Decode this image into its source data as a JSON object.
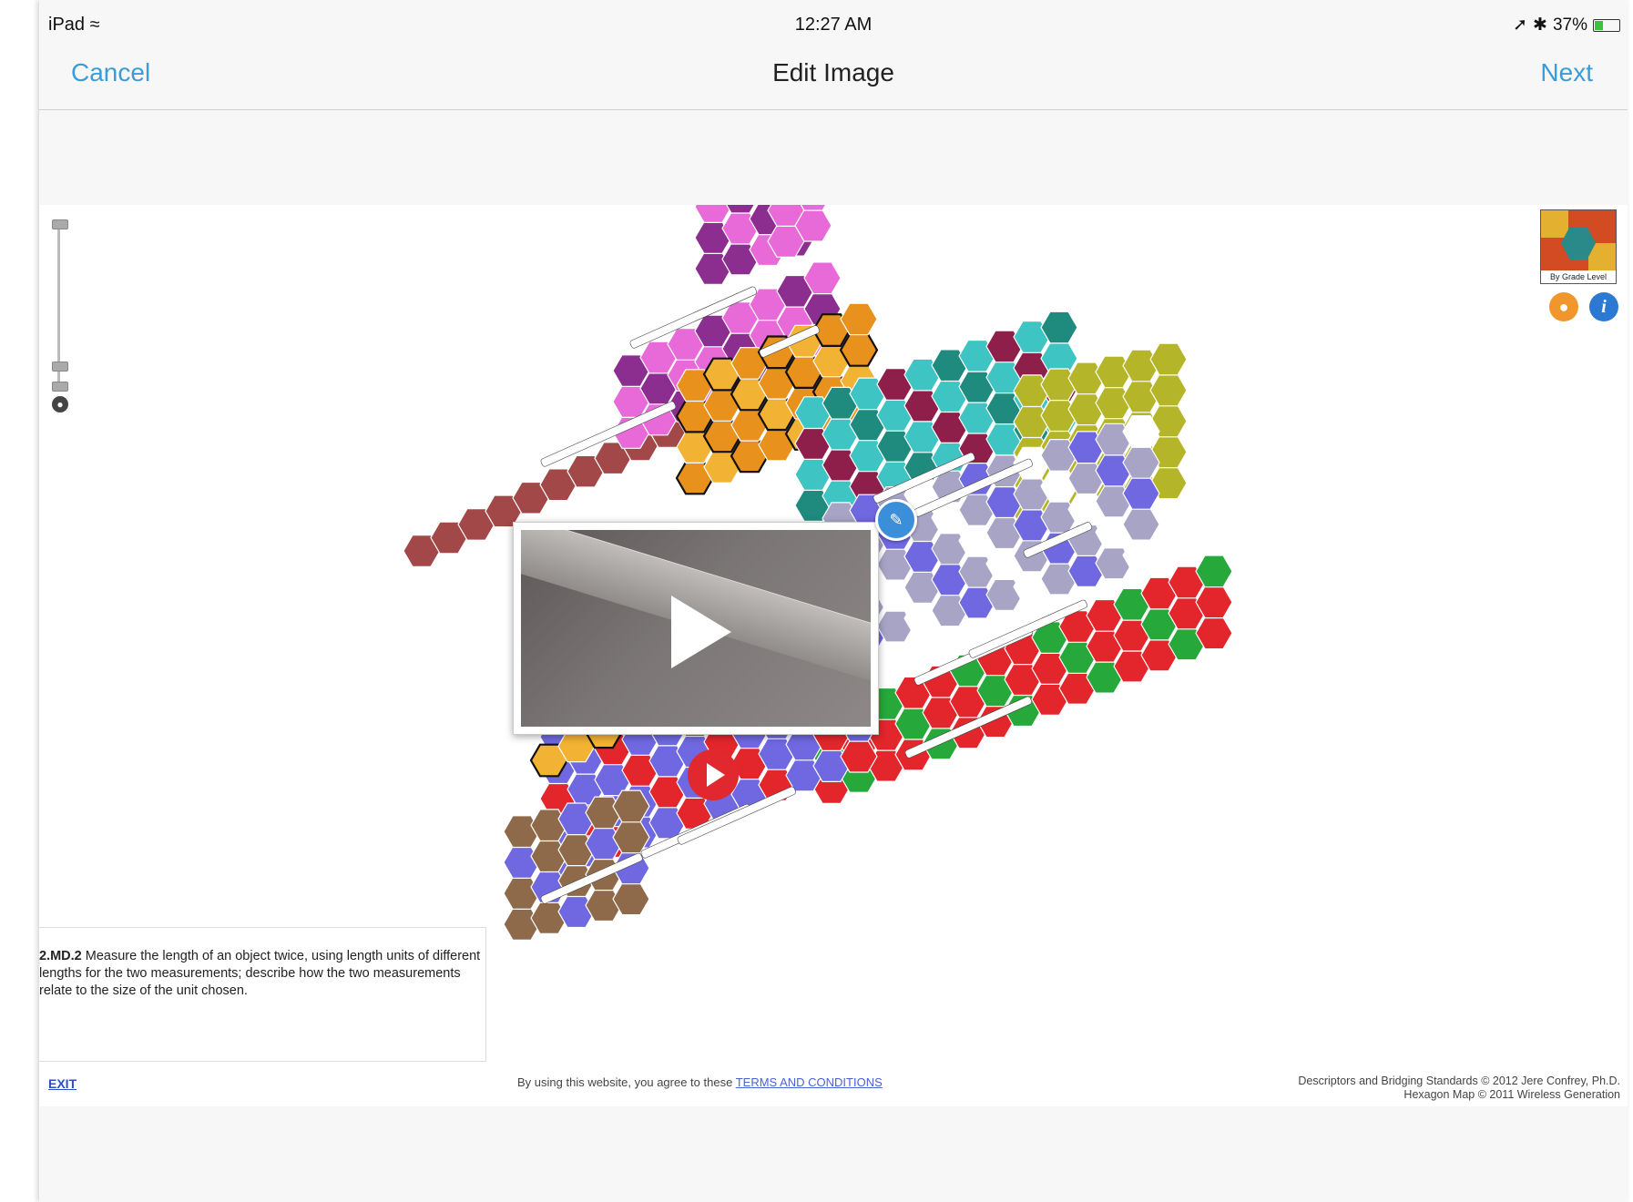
{
  "status_bar": {
    "device": "iPad",
    "time": "12:27 AM",
    "battery_text": "37%",
    "battery_level": 0.37
  },
  "nav": {
    "cancel_label": "Cancel",
    "title": "Edit Image",
    "next_label": "Next"
  },
  "side_panel": {
    "grade_thumb_label": "By Grade Level"
  },
  "standard": {
    "code": "2.MD.2",
    "text": "Measure the length of an object twice, using length units of different lengths for the two measurements; describe how the two measurements relate to the size of the unit chosen."
  },
  "footer": {
    "exit_label": "EXIT",
    "terms_prefix": "By using this website, you agree to these",
    "terms_link": "TERMS AND CONDITIONS",
    "credit_line1": "Descriptors and Bridging Standards © 2012 Jere Confrey, Ph.D.",
    "credit_line2": "Hexagon Map © 2011 Wireless Generation"
  },
  "colors": {
    "accent": "#3a9cd8",
    "link": "#4a62d6",
    "hex_palette": [
      "#8b2e8f",
      "#e86ad8",
      "#e8911c",
      "#f2b233",
      "#1f8a7e",
      "#3fc4c4",
      "#8e1f4b",
      "#b5b52a",
      "#26a83a",
      "#e2262c",
      "#6f68e0",
      "#a7a4c6",
      "#8f6a4a",
      "#a24848",
      "#ffffff"
    ]
  }
}
